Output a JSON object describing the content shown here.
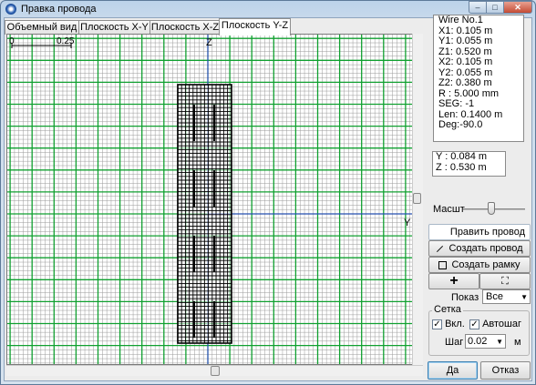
{
  "window": {
    "title": "Правка провода",
    "min": "0",
    "max": "1",
    "close": "r"
  },
  "tabs": [
    "Объемный вид",
    "Плоскость X-Y",
    "Плоскость X-Z",
    "Плоскость Y-Z"
  ],
  "active_tab": 3,
  "ruler": {
    "left": "0",
    "right": "0.25"
  },
  "axes": {
    "z": "Z",
    "y": "Y"
  },
  "wire_info": [
    "Wire No.1",
    "X1: 0.105 m",
    "Y1: 0.055 m",
    "Z1: 0.520 m",
    "X2: 0.105 m",
    "Y2: 0.055 m",
    "Z2: 0.380 m",
    "R : 5.000 mm",
    "SEG: -1",
    "Len: 0.1400 m",
    "Deg:-90.0"
  ],
  "cursor": [
    "Y : 0.084 m",
    "Z : 0.530 m"
  ],
  "scale": {
    "label": "Масшт",
    "value": 0.45
  },
  "buttons": {
    "edit_wire": "Править провод",
    "create_wire": "Создать провод",
    "create_frame": "Создать рамку",
    "add": "+",
    "fit": "⛶"
  },
  "show": {
    "label": "Показ",
    "value": "Все"
  },
  "grid": {
    "title": "Сетка",
    "on_label": "Вкл.",
    "on": true,
    "auto_label": "Автошаг",
    "auto": true,
    "step_label": "Шаг",
    "step": "0.02",
    "unit": "м"
  },
  "ok": "Да",
  "cancel": "Отказ",
  "colors": {
    "grid_major": "#10a030",
    "grid_minor": "#9a9a9a",
    "axis": "#2a3bd0",
    "wire": "#000000"
  }
}
